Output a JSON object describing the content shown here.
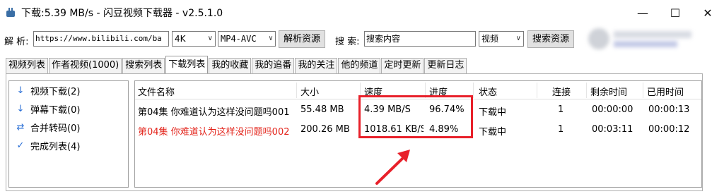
{
  "window": {
    "title": "下载:5.39 MB/s - 闪豆视频下载器 - v2.5.1.0",
    "controls": {
      "minimize": "—",
      "maximize": "☐",
      "close": "✕"
    }
  },
  "toolbar": {
    "parse_label": "解 析:",
    "url_value": "https://www.bilibili.com/ba",
    "quality_value": "4K",
    "format_value": "MP4-AVC",
    "parse_button": "解析资源",
    "search_label": "搜 索:",
    "search_value": "搜索内容",
    "search_type_value": "视频",
    "search_button": "搜索资源"
  },
  "tabs": [
    {
      "label": "视频列表",
      "active": false
    },
    {
      "label": "作者视频(1000)",
      "active": false
    },
    {
      "label": "搜索列表",
      "active": false
    },
    {
      "label": "下载列表",
      "active": true
    },
    {
      "label": "我的收藏",
      "active": false
    },
    {
      "label": "我的追番",
      "active": false
    },
    {
      "label": "我的关注",
      "active": false
    },
    {
      "label": "他的频道",
      "active": false
    },
    {
      "label": "定时更新",
      "active": false
    },
    {
      "label": "更新日志",
      "active": false
    }
  ],
  "leftnav": {
    "items": [
      {
        "icon": "down-arrow-icon",
        "glyph": "↓",
        "label": "视频下载(2)"
      },
      {
        "icon": "down-arrow-icon",
        "glyph": "↓",
        "label": "弹幕下载(0)"
      },
      {
        "icon": "swap-arrows-icon",
        "glyph": "⇄",
        "label": "合并转码(0)"
      },
      {
        "icon": "check-icon",
        "glyph": "✓",
        "label": "完成列表(4)"
      }
    ]
  },
  "table": {
    "columns": [
      "文件名称",
      "大小",
      "速度",
      "进度",
      "状态",
      "连接",
      "剩余时间",
      "已用时间"
    ],
    "rows": [
      {
        "name": "第04集 你难道认为这样没问题吗001",
        "size": "55.48 MB",
        "speed": "4.39 MB/S",
        "progress": "96.74%",
        "status": "下载中",
        "connections": "1",
        "remaining": "00:00:00",
        "elapsed": "00:00:13",
        "color": "#000000"
      },
      {
        "name": "第04集 你难道认为这样没问题吗002",
        "size": "200.26 MB",
        "speed": "1018.61 KB/S",
        "progress": "4.89%",
        "status": "下载中",
        "connections": "1",
        "remaining": "00:03:11",
        "elapsed": "00:00:12",
        "color": "#e3241b"
      }
    ]
  },
  "annotation": {
    "color": "#e8202a"
  }
}
